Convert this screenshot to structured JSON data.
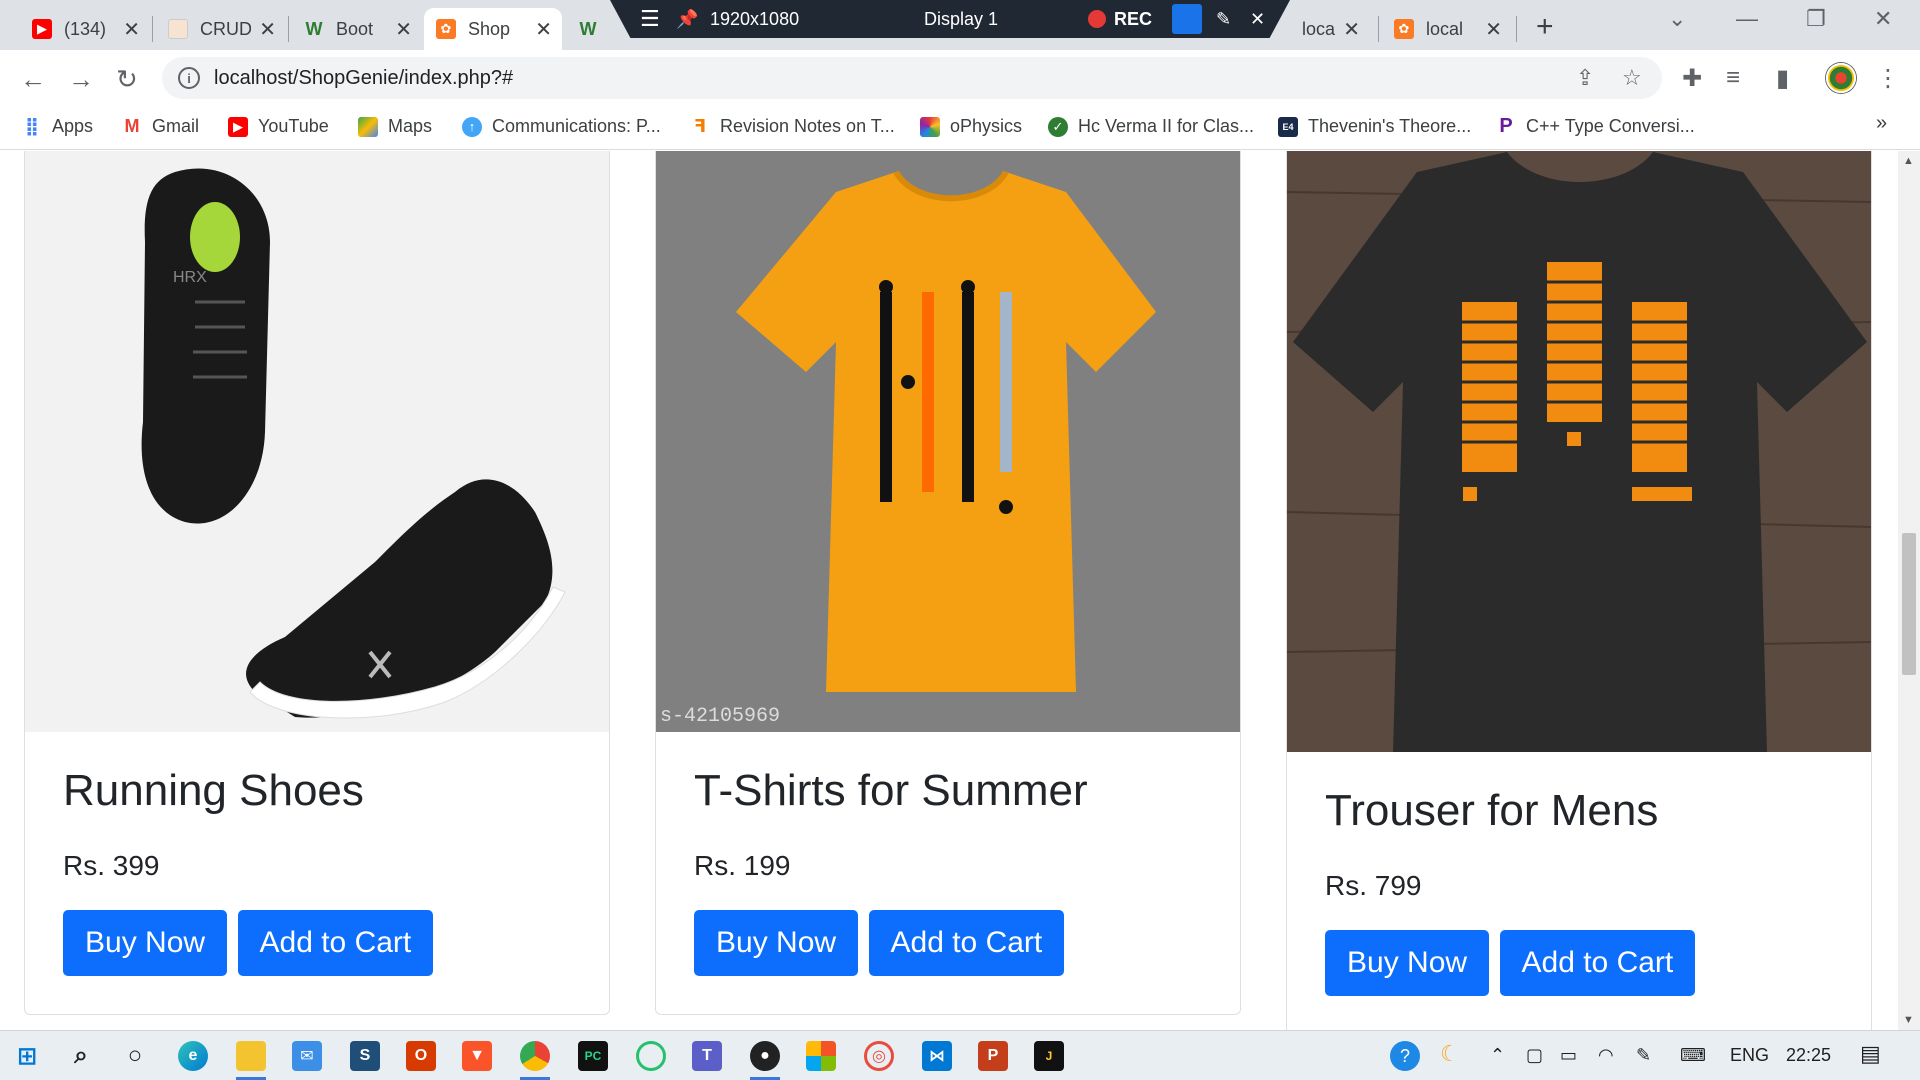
{
  "browser": {
    "tabs": [
      {
        "title": "(134)",
        "favicon": "youtube-icon",
        "color": "#ff0000"
      },
      {
        "title": "CRUD",
        "favicon": "crud-icon",
        "color": "#f4a261"
      },
      {
        "title": "Boot",
        "favicon": "w-icon",
        "color": "#2e7d32"
      },
      {
        "title": "Shop",
        "favicon": "xampp-icon",
        "color": "#fb7a24",
        "active": true
      },
      {
        "title": "W",
        "favicon": "w-icon",
        "color": "#2e7d32"
      },
      {
        "title": "local",
        "favicon": "xampp-icon",
        "color": "#fb7a24"
      },
      {
        "title": "local",
        "favicon": "xampp-icon",
        "color": "#fb7a24"
      }
    ],
    "new_tab_label": "+",
    "url": "localhost/ShopGenie/index.php?#",
    "bookmarks": [
      {
        "label": "Apps",
        "icon": "apps-grid-icon"
      },
      {
        "label": "Gmail",
        "icon": "gmail-icon"
      },
      {
        "label": "YouTube",
        "icon": "youtube-icon"
      },
      {
        "label": "Maps",
        "icon": "maps-icon"
      },
      {
        "label": "Communications: P...",
        "icon": "upload-circle-icon"
      },
      {
        "label": "Revision Notes on T...",
        "icon": "notes-icon"
      },
      {
        "label": "oPhysics",
        "icon": "ophysics-icon"
      },
      {
        "label": "Hc Verma II for Clas...",
        "icon": "check-circle-icon"
      },
      {
        "label": "Thevenin's Theore...",
        "icon": "electrical4u-icon"
      },
      {
        "label": "C++ Type Conversi...",
        "icon": "p-icon"
      }
    ],
    "bookmarks_more": "»"
  },
  "recorder": {
    "resolution": "1920x1080",
    "display": "Display 1",
    "rec_label": "REC"
  },
  "products": [
    {
      "name": "Running Shoes",
      "price": "Rs. 399",
      "buy_label": "Buy Now",
      "cart_label": "Add to Cart",
      "image": "black-running-shoes"
    },
    {
      "name": "T-Shirts for Summer",
      "price": "Rs. 199",
      "buy_label": "Buy Now",
      "cart_label": "Add to Cart",
      "image": "orange-tshirt",
      "watermark": "s-42105969"
    },
    {
      "name": "Trouser for Mens",
      "price": "Rs. 799",
      "buy_label": "Buy Now",
      "cart_label": "Add to Cart",
      "image": "black-tshirt-orange-print"
    }
  ],
  "taskbar": {
    "language": "ENG",
    "time": "22:25"
  },
  "colors": {
    "primary_button": "#0d6efd",
    "tab_strip": "#dee1e6",
    "taskbar": "#e9eef3"
  }
}
